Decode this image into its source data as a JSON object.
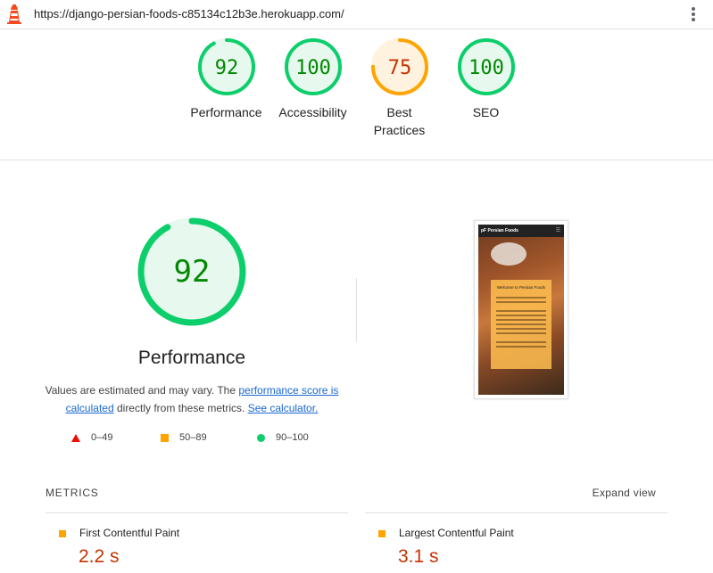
{
  "browser": {
    "url": "https://django-persian-foods-c85134c12b3e.herokuapp.com/",
    "logo_icon": "lighthouse-icon",
    "menu_icon": "kebab-menu-icon"
  },
  "summary": [
    {
      "score": "92",
      "label": "Performance",
      "status": "pass",
      "fraction": 0.92
    },
    {
      "score": "100",
      "label": "Accessibility",
      "status": "pass",
      "fraction": 1.0
    },
    {
      "score": "75",
      "label": "Best Practices",
      "status": "average",
      "fraction": 0.75
    },
    {
      "score": "100",
      "label": "SEO",
      "status": "pass",
      "fraction": 1.0
    }
  ],
  "colors": {
    "pass": "#0cce6b",
    "pass_text": "#008800",
    "pass_bg": "#e7f8ee",
    "average": "#ffa400",
    "average_text": "#c33300",
    "average_bg": "#fff3e0",
    "fail": "#eb0f00",
    "link": "#1967d2"
  },
  "performance": {
    "score": "92",
    "fraction": 0.92,
    "title": "Performance",
    "desc_prefix": "Values are estimated and may vary. The ",
    "link_score": "performance score is calculated",
    "desc_middle": " directly from these metrics. ",
    "link_calc": "See calculator."
  },
  "legend": [
    {
      "range": "0–49",
      "shape": "triangle"
    },
    {
      "range": "50–89",
      "shape": "square"
    },
    {
      "range": "90–100",
      "shape": "circle"
    }
  ],
  "screenshot": {
    "brand": "pF Persian Foods",
    "card_title": "Welcome to Persian Foods"
  },
  "metrics": {
    "title": "METRICS",
    "expand": "Expand view",
    "items": [
      {
        "name": "First Contentful Paint",
        "value": "2.2 s"
      },
      {
        "name": "Largest Contentful Paint",
        "value": "3.1 s"
      }
    ]
  }
}
